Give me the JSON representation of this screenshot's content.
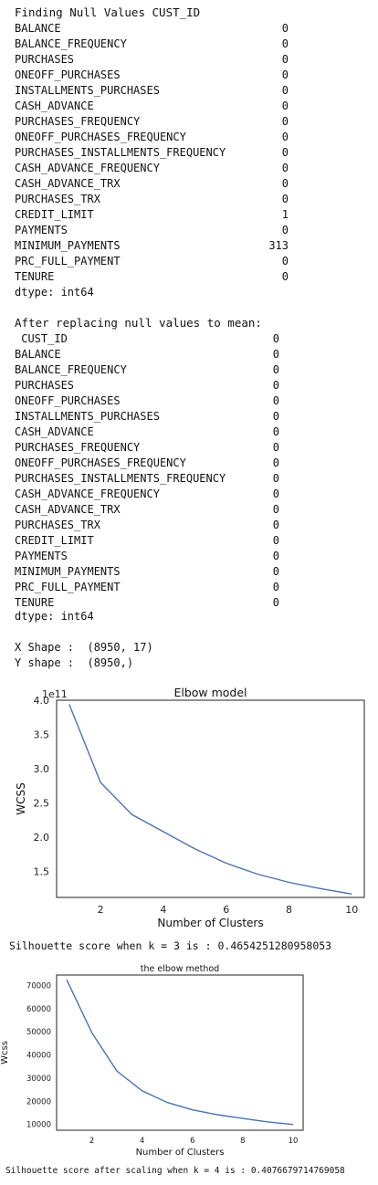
{
  "section1": {
    "header": "Finding Null Values CUST_ID",
    "header_value": "",
    "rows": [
      {
        "name": "BALANCE",
        "count": "0"
      },
      {
        "name": "BALANCE_FREQUENCY",
        "count": "0"
      },
      {
        "name": "PURCHASES",
        "count": "0"
      },
      {
        "name": "ONEOFF_PURCHASES",
        "count": "0"
      },
      {
        "name": "INSTALLMENTS_PURCHASES",
        "count": "0"
      },
      {
        "name": "CASH_ADVANCE",
        "count": "0"
      },
      {
        "name": "PURCHASES_FREQUENCY",
        "count": "0"
      },
      {
        "name": "ONEOFF_PURCHASES_FREQUENCY",
        "count": "0"
      },
      {
        "name": "PURCHASES_INSTALLMENTS_FREQUENCY",
        "count": "0"
      },
      {
        "name": "CASH_ADVANCE_FREQUENCY",
        "count": "0"
      },
      {
        "name": "CASH_ADVANCE_TRX",
        "count": "0"
      },
      {
        "name": "PURCHASES_TRX",
        "count": "0"
      },
      {
        "name": "CREDIT_LIMIT",
        "count": "1"
      },
      {
        "name": "PAYMENTS",
        "count": "0"
      },
      {
        "name": "MINIMUM_PAYMENTS",
        "count": "313"
      },
      {
        "name": "PRC_FULL_PAYMENT",
        "count": "0"
      },
      {
        "name": "TENURE",
        "count": "0"
      }
    ],
    "dtype": "dtype: int64"
  },
  "section2": {
    "header": "After replacing null values to mean:",
    "first_row": {
      "name": " CUST_ID",
      "count": "0"
    },
    "rows": [
      {
        "name": "BALANCE",
        "count": "0"
      },
      {
        "name": "BALANCE_FREQUENCY",
        "count": "0"
      },
      {
        "name": "PURCHASES",
        "count": "0"
      },
      {
        "name": "ONEOFF_PURCHASES",
        "count": "0"
      },
      {
        "name": "INSTALLMENTS_PURCHASES",
        "count": "0"
      },
      {
        "name": "CASH_ADVANCE",
        "count": "0"
      },
      {
        "name": "PURCHASES_FREQUENCY",
        "count": "0"
      },
      {
        "name": "ONEOFF_PURCHASES_FREQUENCY",
        "count": "0"
      },
      {
        "name": "PURCHASES_INSTALLMENTS_FREQUENCY",
        "count": "0"
      },
      {
        "name": "CASH_ADVANCE_FREQUENCY",
        "count": "0"
      },
      {
        "name": "CASH_ADVANCE_TRX",
        "count": "0"
      },
      {
        "name": "PURCHASES_TRX",
        "count": "0"
      },
      {
        "name": "CREDIT_LIMIT",
        "count": "0"
      },
      {
        "name": "PAYMENTS",
        "count": "0"
      },
      {
        "name": "MINIMUM_PAYMENTS",
        "count": "0"
      },
      {
        "name": "PRC_FULL_PAYMENT",
        "count": "0"
      },
      {
        "name": "TENURE",
        "count": "0"
      }
    ],
    "dtype": "dtype: int64"
  },
  "shapes": {
    "x_shape": "X Shape :  (8950, 17)",
    "y_shape": "Y shape :  (8950,)"
  },
  "silhouette1": "Silhouette score when k = 3 is : 0.4654251280958053",
  "silhouette2": "Silhouette score after scaling when k = 4 is : 0.4076679714769058",
  "chart_data": [
    {
      "type": "line",
      "title": "Elbow model",
      "xlabel": "Number of Clusters",
      "ylabel": "WCSS",
      "y_offset_label": "1e11",
      "x": [
        1,
        2,
        3,
        4,
        5,
        6,
        7,
        8,
        9,
        10
      ],
      "values": [
        3.94,
        2.8,
        2.33,
        2.08,
        1.83,
        1.62,
        1.46,
        1.34,
        1.25,
        1.17
      ],
      "xlim": [
        0.6,
        10.4
      ],
      "ylim": [
        1.12,
        4.0
      ],
      "xticks": [
        "2",
        "4",
        "6",
        "8",
        "10"
      ],
      "yticks": [
        "1.5",
        "2.0",
        "2.5",
        "3.0",
        "3.5",
        "4.0"
      ],
      "line_color": "#4c72b0",
      "grid": false
    },
    {
      "type": "line",
      "title": "the elbow method",
      "xlabel": "Number of Clusters",
      "ylabel": "Wcss",
      "x": [
        1,
        2,
        3,
        4,
        5,
        6,
        7,
        8,
        9,
        10
      ],
      "values": [
        72500,
        49600,
        33000,
        24500,
        19500,
        16300,
        14200,
        12600,
        11100,
        10000
      ],
      "xlim": [
        0.6,
        10.4
      ],
      "ylim": [
        7500,
        74500
      ],
      "xticks": [
        "2",
        "4",
        "6",
        "8",
        "10"
      ],
      "yticks": [
        "10000",
        "20000",
        "30000",
        "40000",
        "50000",
        "60000",
        "70000"
      ],
      "line_color": "#4c72b0",
      "grid": false
    }
  ]
}
